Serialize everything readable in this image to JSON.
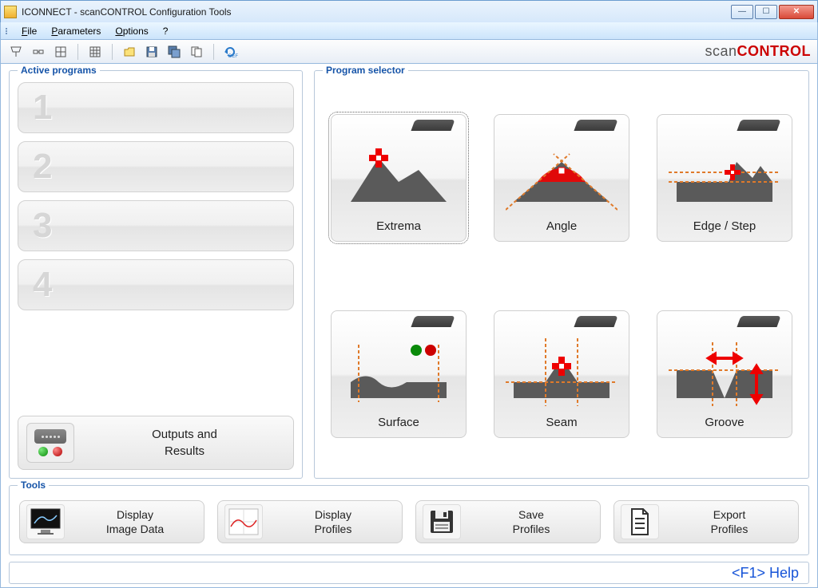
{
  "window": {
    "title": "ICONNECT - scanCONTROL Configuration Tools"
  },
  "menu": {
    "file": "File",
    "parameters": "Parameters",
    "options": "Options",
    "help": "?"
  },
  "brand": {
    "part1": "scan",
    "part2": "CONTROL"
  },
  "groups": {
    "active_programs": "Active programs",
    "program_selector": "Program selector",
    "tools": "Tools"
  },
  "slots": [
    "1",
    "2",
    "3",
    "4"
  ],
  "outputs": {
    "line1": "Outputs and",
    "line2": "Results"
  },
  "programs": [
    {
      "id": "extrema",
      "label": "Extrema"
    },
    {
      "id": "angle",
      "label": "Angle"
    },
    {
      "id": "edgestep",
      "label": "Edge / Step"
    },
    {
      "id": "surface",
      "label": "Surface"
    },
    {
      "id": "seam",
      "label": "Seam"
    },
    {
      "id": "groove",
      "label": "Groove"
    }
  ],
  "tools": [
    {
      "id": "display-image",
      "line1": "Display",
      "line2": "Image Data"
    },
    {
      "id": "display-profiles",
      "line1": "Display",
      "line2": "Profiles"
    },
    {
      "id": "save-profiles",
      "line1": "Save",
      "line2": "Profiles"
    },
    {
      "id": "export-profiles",
      "line1": "Export",
      "line2": "Profiles"
    }
  ],
  "status": {
    "help": "<F1> Help"
  }
}
